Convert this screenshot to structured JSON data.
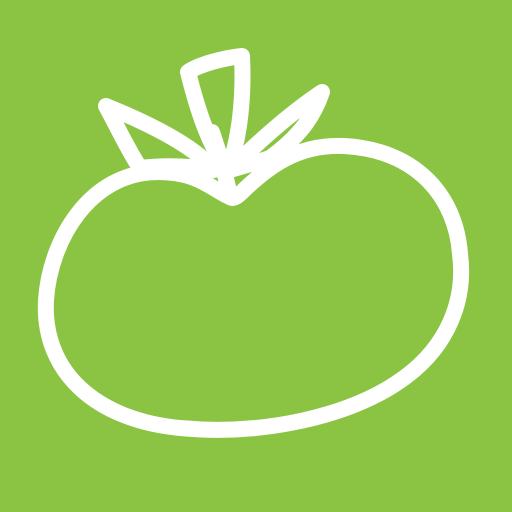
{
  "app_icon": {
    "icon": "tomato-icon",
    "background_color": "#8bc443",
    "stroke_color": "#ffffff"
  }
}
